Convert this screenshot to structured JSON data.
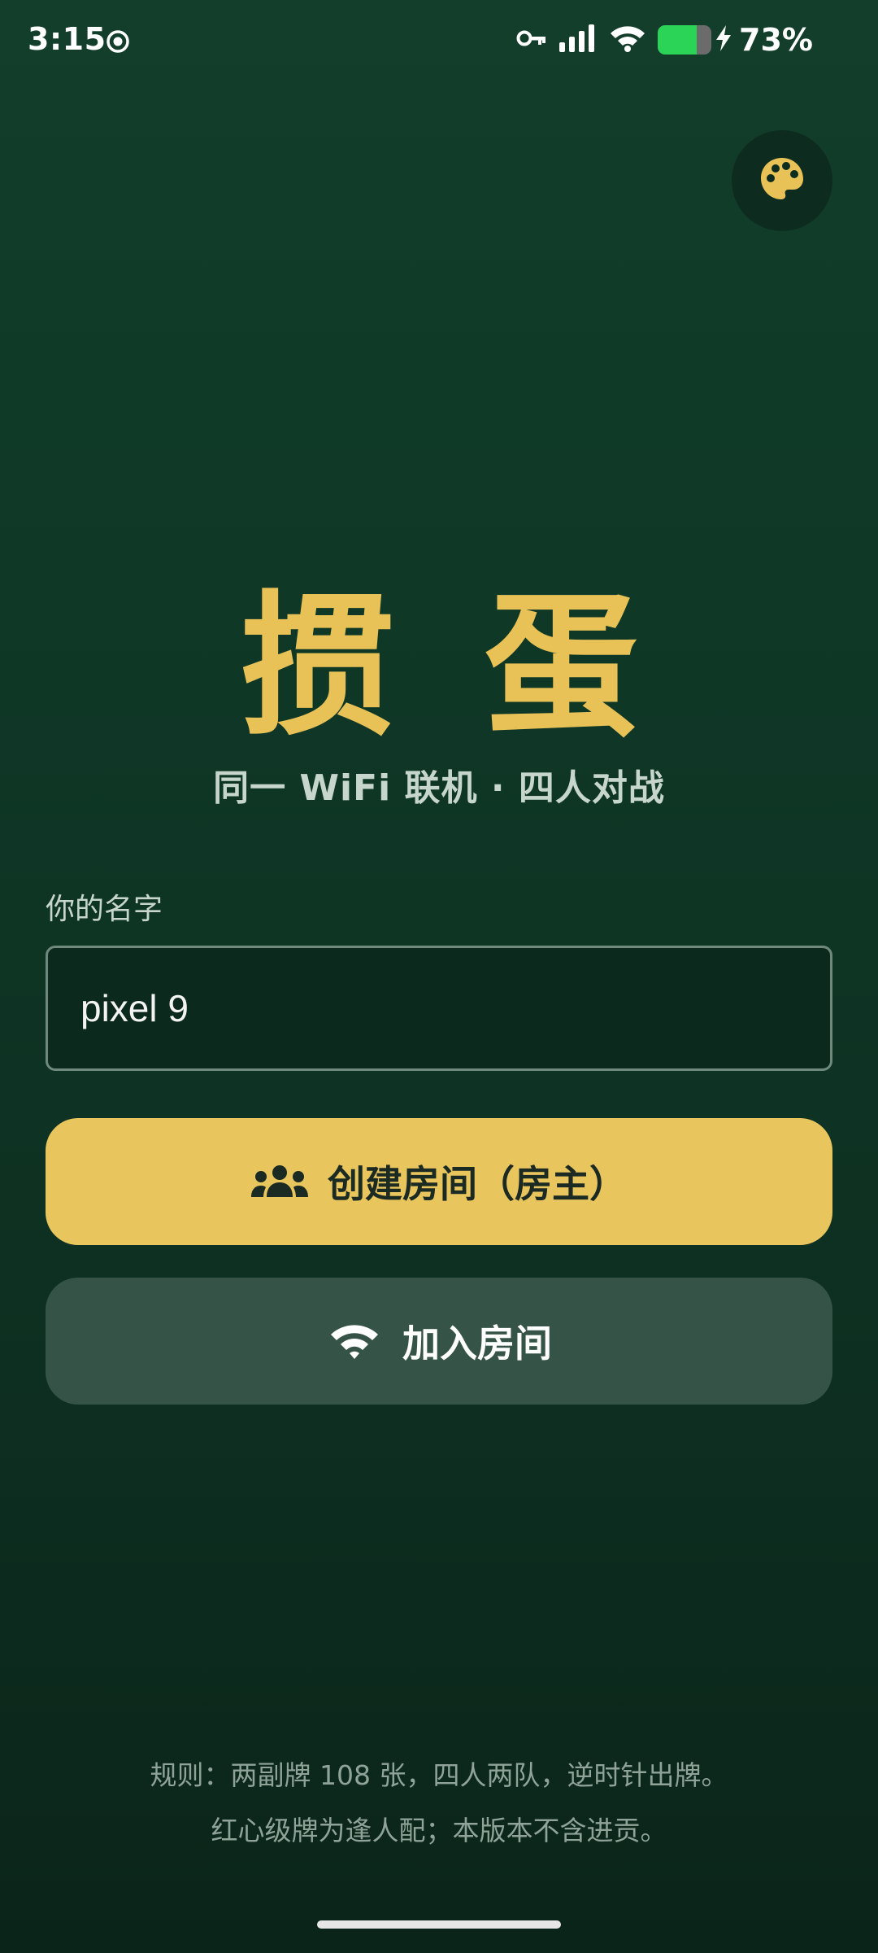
{
  "status_bar": {
    "time": "3:15",
    "battery_percent": "73%",
    "battery_level": 0.73,
    "icons": [
      "target-icon",
      "vpn-key-icon",
      "signal-icon",
      "wifi-icon",
      "battery-icon",
      "charging-bolt-icon"
    ]
  },
  "header": {
    "theme_button_icon": "palette-icon"
  },
  "title": {
    "app_name": "掼 蛋",
    "subtitle": "同一 WiFi 联机 · 四人对战"
  },
  "name_field": {
    "label": "你的名字",
    "value": "pixel 9"
  },
  "buttons": {
    "create_label": "创建房间（房主）",
    "create_icon": "group-icon",
    "join_label": "加入房间",
    "join_icon": "wifi-icon"
  },
  "footer": {
    "rules_line1": "规则：两副牌 108 张，四人两队，逆时针出牌。",
    "rules_line2": "红心级牌为逢人配；本版本不含进贡。"
  },
  "colors": {
    "accent": "#e8c257",
    "background_top": "#123e2b",
    "background_bottom": "#0b2419",
    "join_button": "#355346"
  }
}
